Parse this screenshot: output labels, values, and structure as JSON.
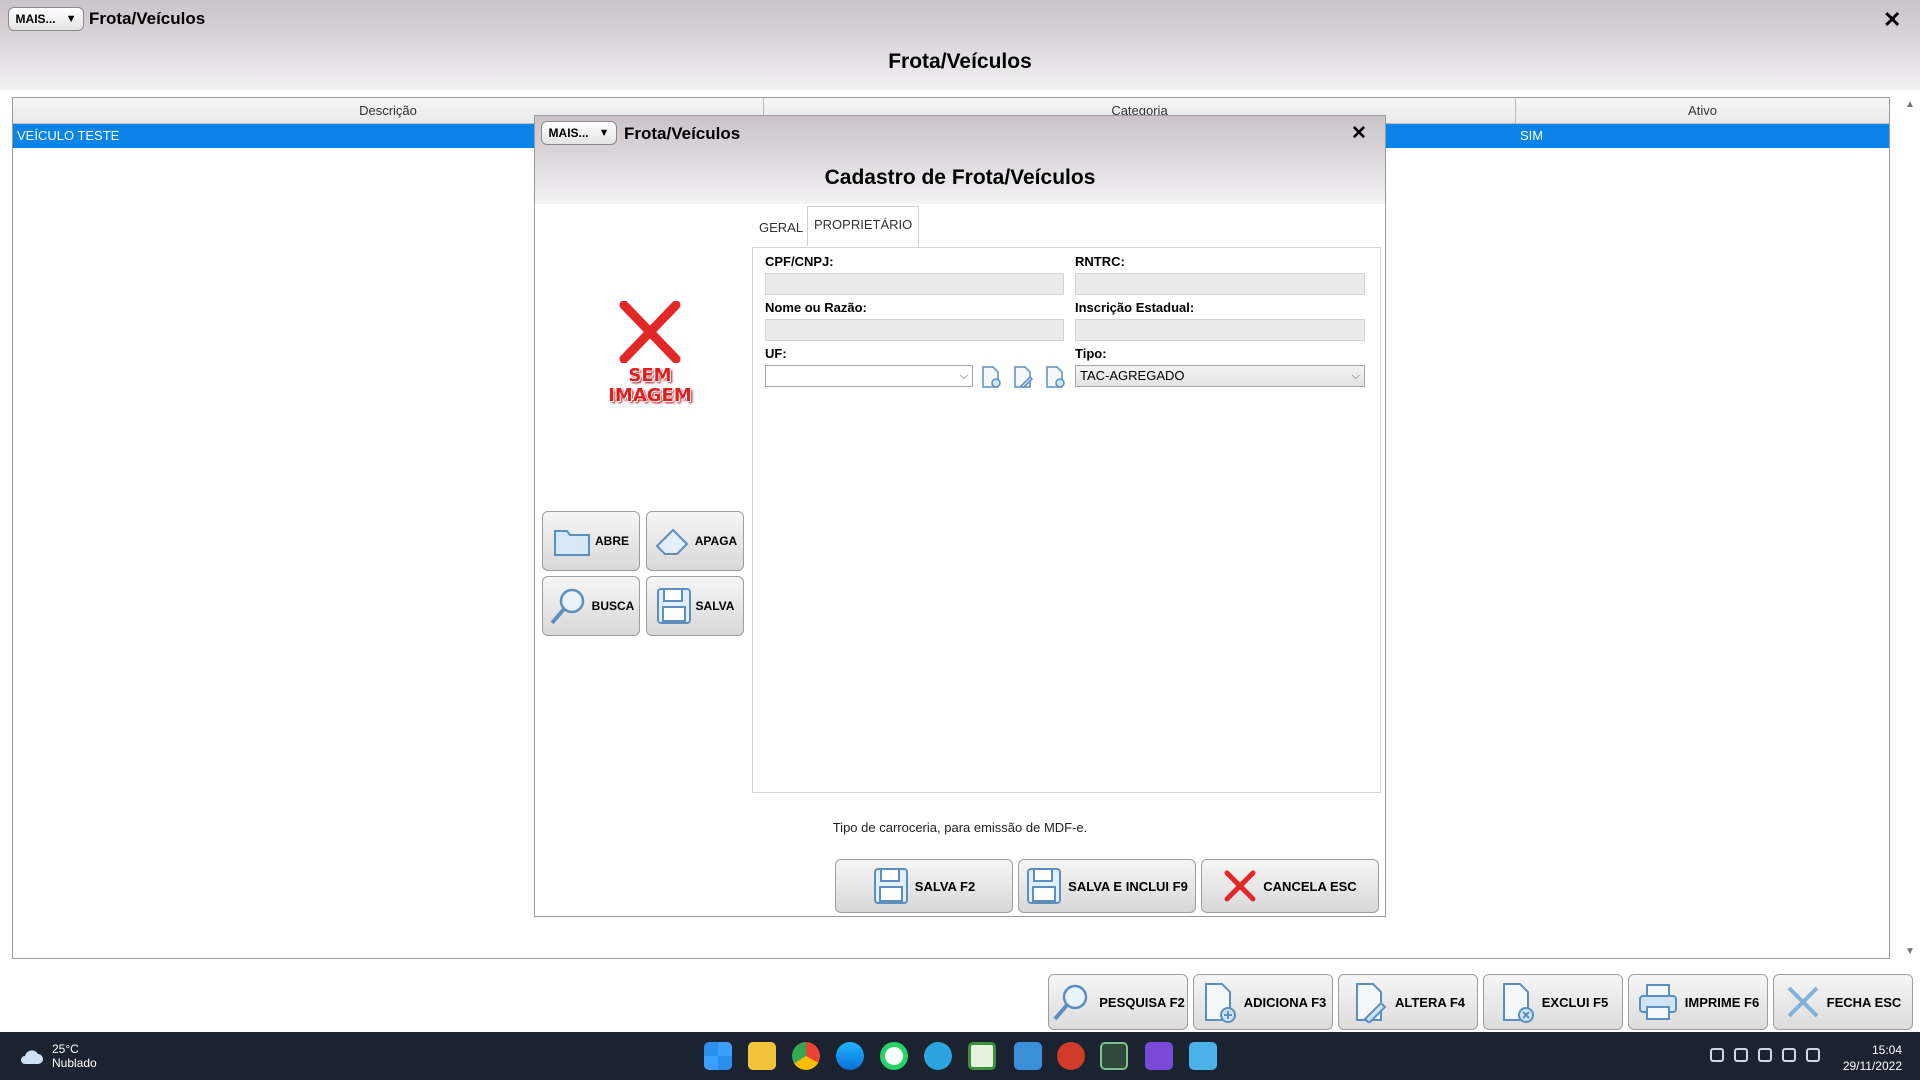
{
  "main": {
    "mais_label": "MAIS...",
    "window_title": "Frota/Veículos",
    "header_title": "Frota/Veículos",
    "close_glyph": "✕",
    "grid": {
      "columns": [
        "Descrição",
        "Categoria",
        "Ativo"
      ],
      "rows": [
        {
          "descricao": "VEÍCULO TESTE",
          "categoria": "",
          "ativo": "SIM",
          "selected": true
        }
      ],
      "selected_color": "#0a84e8"
    },
    "toolbar": [
      {
        "label": "PESQUISA F2",
        "icon": "magnifier-icon"
      },
      {
        "label": "ADICIONA F3",
        "icon": "add-document-icon"
      },
      {
        "label": "ALTERA F4",
        "icon": "edit-document-icon"
      },
      {
        "label": "EXCLUI F5",
        "icon": "delete-document-icon"
      },
      {
        "label": "IMPRIME F6",
        "icon": "printer-icon"
      },
      {
        "label": "FECHA ESC",
        "icon": "close-icon"
      }
    ]
  },
  "modal": {
    "mais_label": "MAIS...",
    "window_title": "Frota/Veículos",
    "close_glyph": "✕",
    "header_title": "Cadastro de Frota/Veículos",
    "no_image_line1": "SEM",
    "no_image_line2": "IMAGEM",
    "image_buttons": {
      "abre": "ABRE",
      "apaga": "APAGA",
      "busca": "BUSCA",
      "salva": "SALVA"
    },
    "tabs": [
      {
        "label": "GERAL",
        "active": false
      },
      {
        "label": "PROPRIETÁRIO",
        "active": true
      }
    ],
    "fields": {
      "cpf_label": "CPF/CNPJ:",
      "cpf_value": "",
      "rntrc_label": "RNTRC:",
      "rntrc_value": "",
      "nome_label": "Nome ou Razão:",
      "nome_value": "",
      "ie_label": "Inscrição Estadual:",
      "ie_value": "",
      "uf_label": "UF:",
      "uf_value": "",
      "tipo_label": "Tipo:",
      "tipo_value": "TAC-AGREGADO"
    },
    "hint": "Tipo de carroceria, para emissão de MDF-e.",
    "buttons": {
      "salva": "SALVA F2",
      "salva_inclui": "SALVA E INCLUI F9",
      "cancela": "CANCELA ESC"
    }
  },
  "taskbar": {
    "temperature": "25°C",
    "weather": "Nublado",
    "time": "15:04",
    "date": "29/11/2022"
  }
}
